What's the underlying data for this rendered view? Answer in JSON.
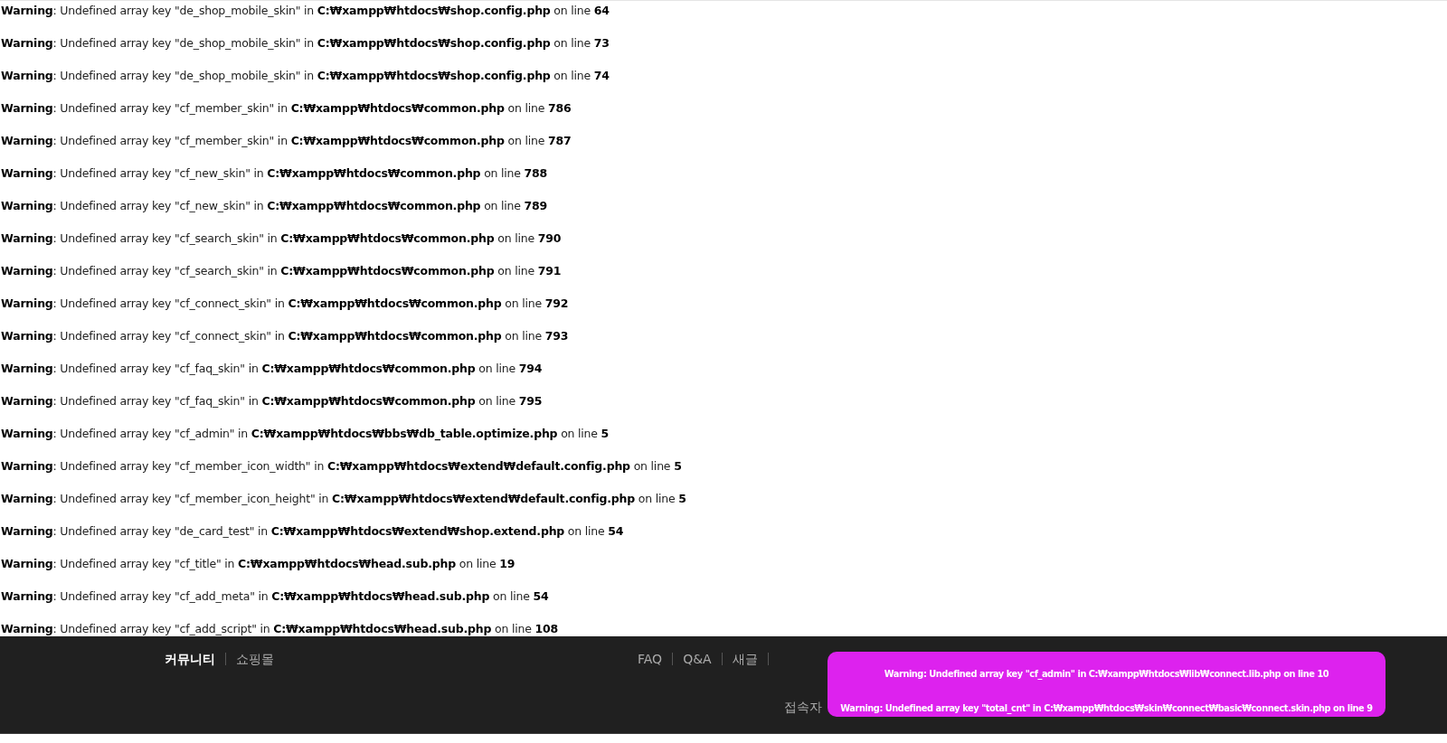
{
  "warnings": [
    "**Warning**: Undefined array key \"de_shop_mobile_skin\" in **C:₩xampp₩htdocs₩shop.config.php** on line **64**",
    "**Warning**: Undefined array key \"de_shop_mobile_skin\" in **C:₩xampp₩htdocs₩shop.config.php** on line **73**",
    "**Warning**: Undefined array key \"de_shop_mobile_skin\" in **C:₩xampp₩htdocs₩shop.config.php** on line **74**",
    "**Warning**: Undefined array key \"cf_member_skin\" in **C:₩xampp₩htdocs₩common.php** on line **786**",
    "**Warning**: Undefined array key \"cf_member_skin\" in **C:₩xampp₩htdocs₩common.php** on line **787**",
    "**Warning**: Undefined array key \"cf_new_skin\" in **C:₩xampp₩htdocs₩common.php** on line **788**",
    "**Warning**: Undefined array key \"cf_new_skin\" in **C:₩xampp₩htdocs₩common.php** on line **789**",
    "**Warning**: Undefined array key \"cf_search_skin\" in **C:₩xampp₩htdocs₩common.php** on line **790**",
    "**Warning**: Undefined array key \"cf_search_skin\" in **C:₩xampp₩htdocs₩common.php** on line **791**",
    "**Warning**: Undefined array key \"cf_connect_skin\" in **C:₩xampp₩htdocs₩common.php** on line **792**",
    "**Warning**: Undefined array key \"cf_connect_skin\" in **C:₩xampp₩htdocs₩common.php** on line **793**",
    "**Warning**: Undefined array key \"cf_faq_skin\" in **C:₩xampp₩htdocs₩common.php** on line **794**",
    "**Warning**: Undefined array key \"cf_faq_skin\" in **C:₩xampp₩htdocs₩common.php** on line **795**",
    "**Warning**: Undefined array key \"cf_admin\" in **C:₩xampp₩htdocs₩bbs₩db_table.optimize.php** on line **5**",
    "**Warning**: Undefined array key \"cf_member_icon_width\" in **C:₩xampp₩htdocs₩extend₩default.config.php** on line **5**",
    "**Warning**: Undefined array key \"cf_member_icon_height\" in **C:₩xampp₩htdocs₩extend₩default.config.php** on line **5**",
    "**Warning**: Undefined array key \"de_card_test\" in **C:₩xampp₩htdocs₩extend₩shop.extend.php** on line **54**",
    "**Warning**: Undefined array key \"cf_title\" in **C:₩xampp₩htdocs₩head.sub.php** on line **19**",
    "**Warning**: Undefined array key \"cf_add_meta\" in **C:₩xampp₩htdocs₩head.sub.php** on line **54**",
    "**Warning**: Undefined array key \"cf_add_script\" in **C:₩xampp₩htdocs₩head.sub.php** on line **108**"
  ],
  "footer": {
    "site_tabs": [
      {
        "label": "커뮤니티",
        "selected": true
      },
      {
        "label": "쇼핑몰",
        "selected": false
      }
    ],
    "links": [
      "FAQ",
      "Q&A",
      "새글"
    ],
    "visitor_label": "접속자",
    "error_popup": [
      "Warning: Undefined array key \"cf_admin\" in C:₩xampp₩htdocs₩lib₩connect.lib.php on line 10",
      "Warning: Undefined array key \"total_cnt\" in C:₩xampp₩htdocs₩skin₩connect₩basic₩connect.skin.php on line 9"
    ]
  }
}
